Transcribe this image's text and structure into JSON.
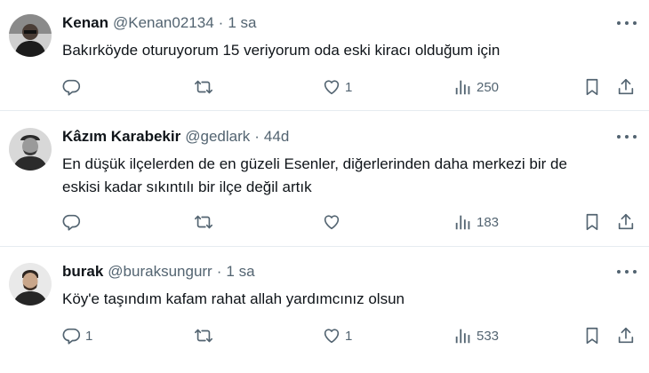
{
  "tweets": [
    {
      "name": "Kenan",
      "handle": "@Kenan02134",
      "separator": "·",
      "time": "1 sa",
      "text_lines": [
        "Bakırköyde oturuyorum 15 veriyorum oda eski kiracı olduğum için"
      ],
      "replies": "",
      "likes": "1",
      "views": "250"
    },
    {
      "name": "Kâzım Karabekir",
      "handle": "@gedlark",
      "separator": "·",
      "time": "44d",
      "text_lines": [
        "En düşük ilçelerden de en güzeli Esenler, diğerlerinden daha merkezi bir de",
        "eskisi kadar sıkıntılı bir ilçe değil artık"
      ],
      "replies": "",
      "likes": "",
      "views": "183"
    },
    {
      "name": "burak",
      "handle": "@buraksungurr",
      "separator": "·",
      "time": "1 sa",
      "text_lines": [
        "Köy'e taşındım kafam rahat allah yardımcınız olsun"
      ],
      "replies": "1",
      "likes": "1",
      "views": "533"
    }
  ],
  "icons": {
    "reply": "reply-icon",
    "retweet": "retweet-icon",
    "like": "heart-icon",
    "views": "views-icon",
    "bookmark": "bookmark-icon",
    "share": "share-icon",
    "more": "more-icon"
  },
  "colors": {
    "text": "#0f1419",
    "secondary": "#536471",
    "divider": "#e6ecf0"
  }
}
